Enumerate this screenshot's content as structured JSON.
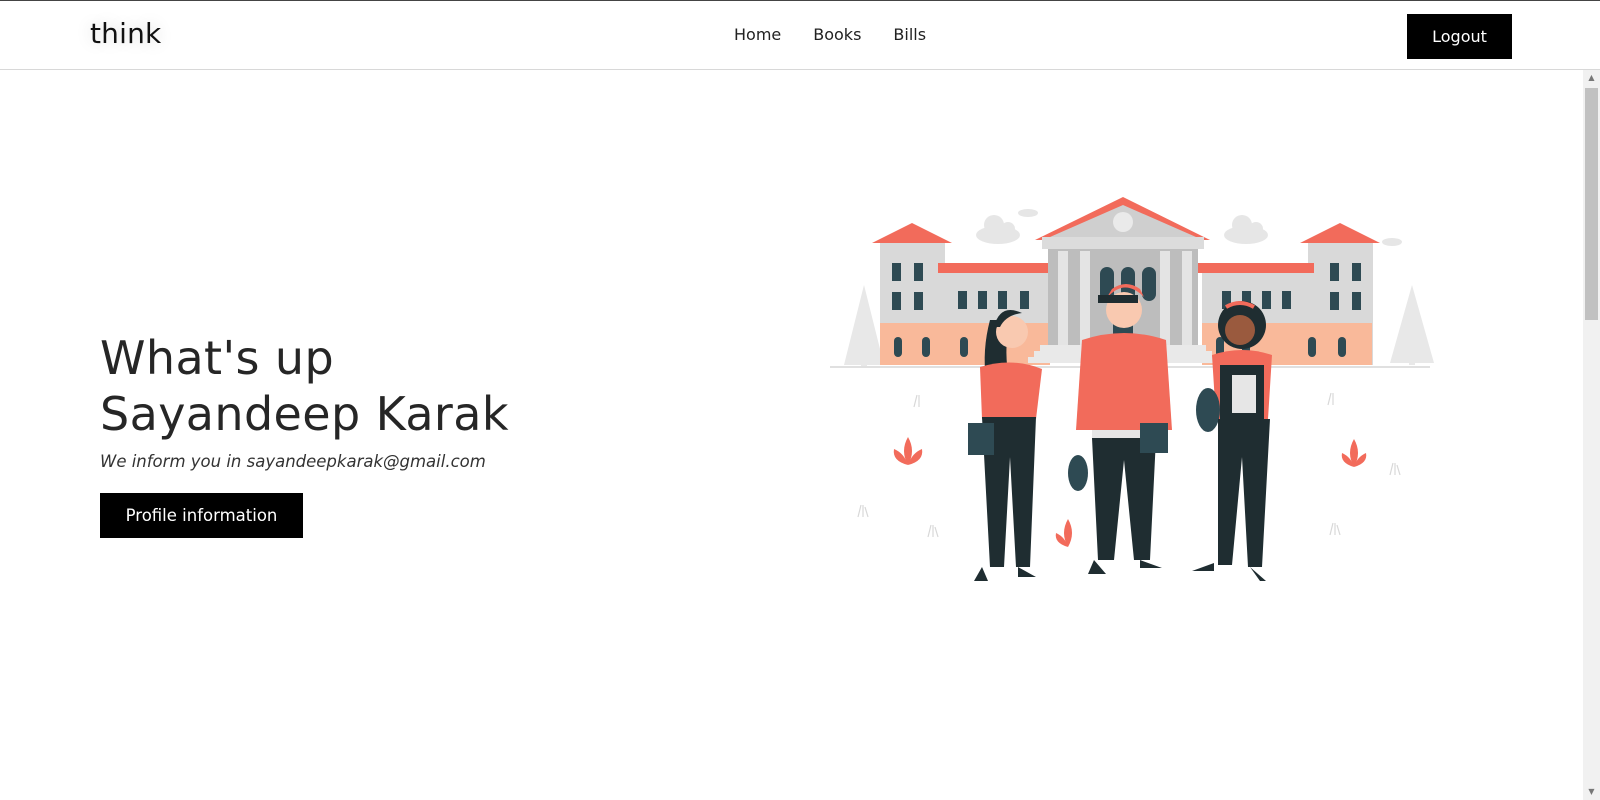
{
  "navbar": {
    "brand": "think",
    "links": [
      {
        "label": "Home"
      },
      {
        "label": "Books"
      },
      {
        "label": "Bills"
      }
    ],
    "logout_label": "Logout"
  },
  "hero": {
    "greeting_line1": "What's up",
    "greeting_line2": "Sayandeep Karak",
    "email_line": "We inform you in sayandeepkarak@gmail.com",
    "profile_button_label": "Profile information"
  },
  "illustration": {
    "subject": "students-in-front-of-university-illustration",
    "accent_color": "#f26b5b",
    "dark_color": "#1f2d31",
    "building_color": "#d8d8d8"
  },
  "colors": {
    "button_bg": "#000000",
    "button_text": "#ffffff",
    "text": "#262626"
  }
}
